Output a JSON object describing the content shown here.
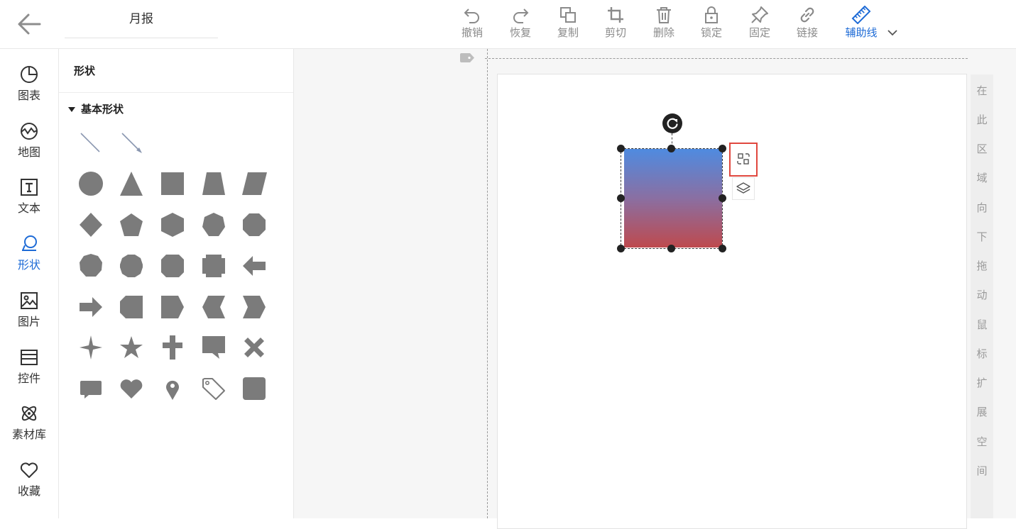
{
  "header": {
    "doc_title": "月报",
    "toolbar": [
      {
        "id": "undo",
        "label": "撤销",
        "icon": "undo-icon"
      },
      {
        "id": "redo",
        "label": "恢复",
        "icon": "redo-icon"
      },
      {
        "id": "copy",
        "label": "复制",
        "icon": "copy-icon"
      },
      {
        "id": "cut",
        "label": "剪切",
        "icon": "crop-icon"
      },
      {
        "id": "delete",
        "label": "删除",
        "icon": "trash-icon"
      },
      {
        "id": "lock",
        "label": "锁定",
        "icon": "lock-icon"
      },
      {
        "id": "pin",
        "label": "固定",
        "icon": "pin-icon"
      },
      {
        "id": "link",
        "label": "链接",
        "icon": "link-icon"
      },
      {
        "id": "guides",
        "label": "辅助线",
        "icon": "ruler-icon",
        "active": true
      }
    ]
  },
  "sidebar": {
    "items": [
      {
        "label": "图表",
        "icon": "chart-pie-icon"
      },
      {
        "label": "地图",
        "icon": "map-globe-icon"
      },
      {
        "label": "文本",
        "icon": "text-icon"
      },
      {
        "label": "形状",
        "icon": "shapes-icon",
        "active": true
      },
      {
        "label": "图片",
        "icon": "image-icon"
      },
      {
        "label": "控件",
        "icon": "widget-icon"
      },
      {
        "label": "素材库",
        "icon": "atom-icon"
      },
      {
        "label": "收藏",
        "icon": "heart-outline-icon"
      }
    ]
  },
  "panel": {
    "title": "形状",
    "section": "基本形状",
    "shapes": [
      "line",
      "arrow-line",
      "circle",
      "triangle",
      "square",
      "trapezoid",
      "parallelogram",
      "diamond",
      "pentagon",
      "hexagon",
      "heptagon",
      "octagon",
      "nonagon",
      "decagon",
      "dodecagon",
      "notched-square",
      "left-arrow",
      "right-arrow",
      "snipped-left",
      "pentagon-arrow",
      "chevron-left",
      "chevron-right",
      "four-point-star",
      "five-point-star",
      "cross",
      "callout",
      "x-mark",
      "speech-bubble",
      "heart",
      "map-pin",
      "tag",
      "rounded-square"
    ]
  },
  "canvas": {
    "hint_chars": [
      "在",
      "此",
      "区",
      "域",
      "向",
      "下",
      "拖",
      "动",
      "鼠",
      "标",
      "扩",
      "展",
      "空",
      "间"
    ],
    "selected_shape": {
      "gradient_top": "#4f8be0",
      "gradient_bottom": "#be4a4e"
    }
  },
  "colors": {
    "accent": "#1e6bd6",
    "highlight": "#e0473e",
    "shape_gray": "#7b7b7b"
  }
}
